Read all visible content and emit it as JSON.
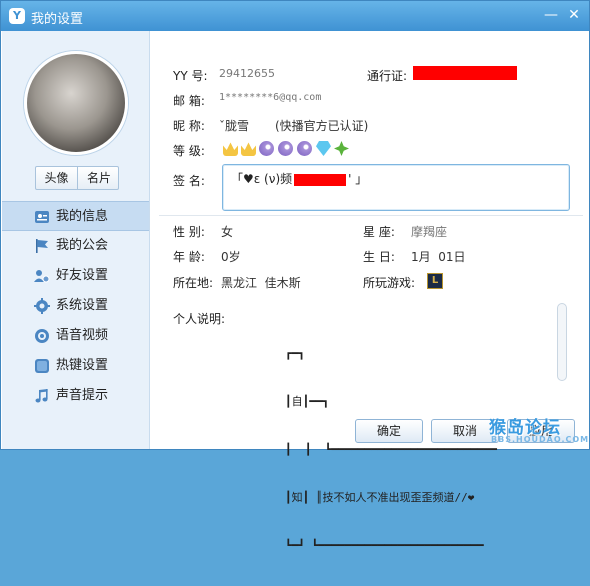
{
  "window": {
    "title": "我的设置",
    "minimize_glyph": "—",
    "close_glyph": "✕"
  },
  "colors": {
    "titlebar": "#4a9ad8",
    "accent": "#3f92d3",
    "redaction": "#ff0000",
    "nav_active": "#c6dcf2"
  },
  "sidebar": {
    "avatar_tabs": [
      "头像",
      "名片"
    ],
    "items": [
      {
        "label": "我的信息",
        "icon": "profile-card-icon",
        "active": true
      },
      {
        "label": "我的公会",
        "icon": "flag-icon",
        "active": false
      },
      {
        "label": "好友设置",
        "icon": "friends-gear-icon",
        "active": false
      },
      {
        "label": "系统设置",
        "icon": "gear-icon",
        "active": false
      },
      {
        "label": "语音视频",
        "icon": "speaker-icon",
        "active": false
      },
      {
        "label": "热键设置",
        "icon": "hotkey-icon",
        "active": false
      },
      {
        "label": "声音提示",
        "icon": "music-note-icon",
        "active": false
      }
    ]
  },
  "profile": {
    "yy_label": "YY 号:",
    "yy_value": "29412655",
    "passport_label": "通行证:",
    "email_label": "邮 箱:",
    "email_value": "1********6@qq.com",
    "nickname_label": "昵 称:",
    "nickname_value": "ˇ胧雪",
    "nickname_note": "(快播官方已认证)",
    "level_label": "等 级:",
    "level_icons": [
      "crown-icon",
      "crown-icon",
      "moon-icon",
      "moon-icon",
      "moon-icon",
      "diamond-icon",
      "clover-icon"
    ],
    "signature_label": "签 名:",
    "signature_prefix": "「♥ε (ν)频",
    "signature_suffix": "' 」",
    "gender_label": "性 别:",
    "gender_value": "女",
    "constellation_label": "星 座:",
    "constellation_value": "摩羯座",
    "age_label": "年 龄:",
    "age_value": "0岁",
    "birthday_label": "生 日:",
    "birthday_value": "1月  01日",
    "location_label": "所在地:",
    "location_value": "黑龙江  佳木斯",
    "games_label": "所玩游戏:",
    "game_icon": "league-of-legends-icon",
    "game_icon_glyph": "L",
    "description_label": "个人说明:",
    "description_lines": [
      "┏━┓",
      "┃自┃━━┓",
      "┃  ┃  ┗━━━━━━━━━━━━━━━━━━━━━━━━━",
      "┃知┃ ║技不如人不准出现歪歪频道//❤",
      "┗━┛ ┗━━━━━━━━━━━━━━━━━━━━━━━━━"
    ]
  },
  "buttons": {
    "ok": "确定",
    "cancel": "取消",
    "apply": "应用"
  },
  "watermark": {
    "main": "猴岛论坛",
    "sub": "BBS.HOUDAO.COM"
  }
}
